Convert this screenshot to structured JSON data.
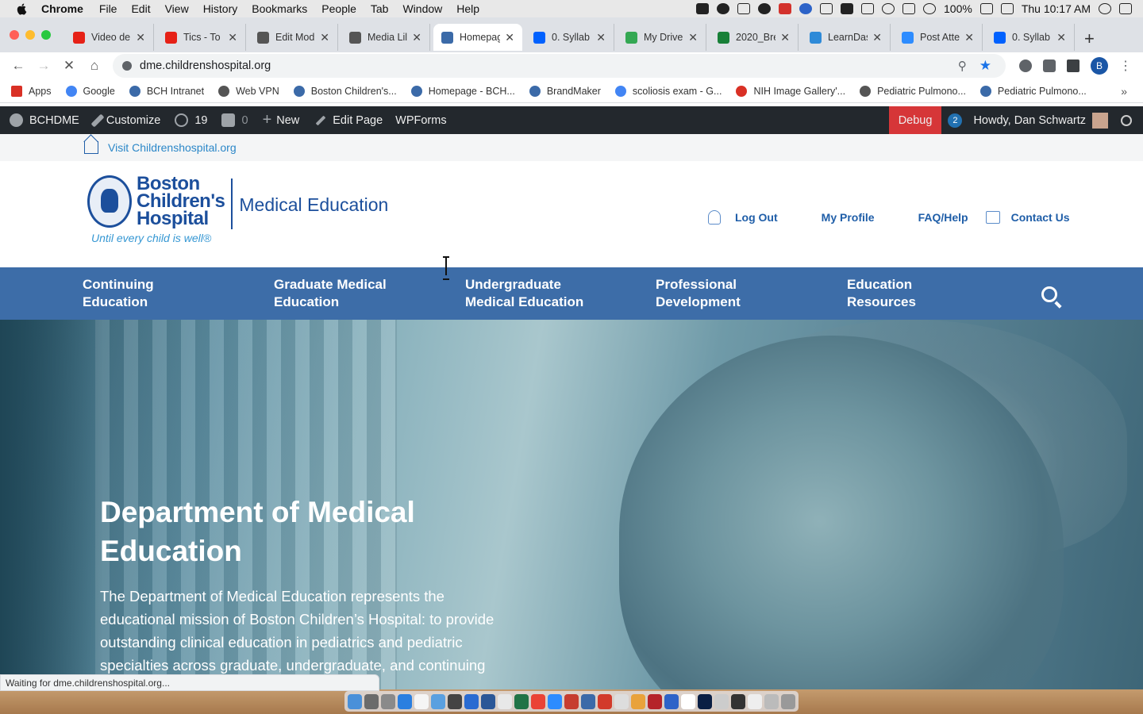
{
  "menubar": {
    "app": "Chrome",
    "items": [
      "File",
      "Edit",
      "View",
      "History",
      "Bookmarks",
      "People",
      "Tab",
      "Window",
      "Help"
    ],
    "battery": "100%",
    "clock": "Thu 10:17 AM"
  },
  "tabs": [
    {
      "label": "Video de",
      "color": "#e62117"
    },
    {
      "label": "Tics - To",
      "color": "#e62117"
    },
    {
      "label": "Edit Mod",
      "color": "#555555"
    },
    {
      "label": "Media Lil",
      "color": "#555555"
    },
    {
      "label": "Homepag",
      "color": "#3b6aa8"
    },
    {
      "label": "0. Syllab",
      "color": "#0061fe"
    },
    {
      "label": "My Drive",
      "color": "#34a853"
    },
    {
      "label": "2020_Bre",
      "color": "#188038"
    },
    {
      "label": "LearnDas",
      "color": "#2e8ad8"
    },
    {
      "label": "Post Atte",
      "color": "#2d8cff"
    },
    {
      "label": "0. Syllab",
      "color": "#0061fe"
    }
  ],
  "address": {
    "url": "dme.childrenshospital.org"
  },
  "bookmarks": [
    {
      "label": "Apps",
      "color": "#d93025"
    },
    {
      "label": "Google",
      "color": "#4285f4"
    },
    {
      "label": "BCH Intranet",
      "color": "#3b6aa8"
    },
    {
      "label": "Web VPN",
      "color": "#555555"
    },
    {
      "label": "Boston Children's...",
      "color": "#3b6aa8"
    },
    {
      "label": "Homepage - BCH...",
      "color": "#3b6aa8"
    },
    {
      "label": "BrandMaker",
      "color": "#3b6aa8"
    },
    {
      "label": "scoliosis exam - G...",
      "color": "#4285f4"
    },
    {
      "label": "NIH Image Gallery'...",
      "color": "#d93025"
    },
    {
      "label": "Pediatric Pulmono...",
      "color": "#555555"
    },
    {
      "label": "Pediatric Pulmono...",
      "color": "#3b6aa8"
    }
  ],
  "wpbar": {
    "site": "BCHDME",
    "customize": "Customize",
    "updates": "19",
    "comments": "0",
    "new": "New",
    "edit": "Edit Page",
    "forms": "WPForms",
    "debug": "Debug",
    "notices": "2",
    "howdy": "Howdy, Dan Schwartz"
  },
  "visit": {
    "link": "Visit Childrenshospital.org"
  },
  "header": {
    "logo_line1": "Boston",
    "logo_line2": "Children's",
    "logo_line3": "Hospital",
    "logo_dept": "Medical Education",
    "tagline": "Until every child is well®",
    "links": {
      "logout": "Log Out",
      "profile": "My Profile",
      "faq": "FAQ/Help",
      "contact": "Contact Us"
    }
  },
  "nav": [
    {
      "line1": "Continuing",
      "line2": "Education"
    },
    {
      "line1": "Graduate Medical",
      "line2": "Education"
    },
    {
      "line1": "Undergraduate",
      "line2": "Medical Education"
    },
    {
      "line1": "Professional",
      "line2": "Development"
    },
    {
      "line1": "Education",
      "line2": "Resources"
    }
  ],
  "hero": {
    "title": "Department of Medical Education",
    "body": "The Department of Medical Education represents the educational mission of Boston Children’s Hospital: to provide outstanding clinical education in pediatrics and pediatric specialties across graduate, undergraduate, and continuing"
  },
  "status": {
    "text": "Waiting for dme.childrenshospital.org..."
  },
  "colors": {
    "nav_blue": "#3d6da8",
    "brand_blue": "#1c4f9c",
    "wp_dark": "#23282d",
    "debug_red": "#d63638"
  }
}
